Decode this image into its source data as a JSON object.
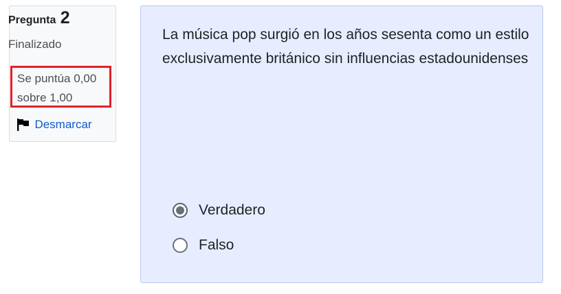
{
  "question_info": {
    "label": "Pregunta",
    "number": "2",
    "state": "Finalizado",
    "grade": "Se puntúa 0,00 sobre 1,00",
    "flag_action": "Desmarcar"
  },
  "question": {
    "text": "La música pop surgió en los años sesenta como un estilo exclusivamente británico sin influencias estadounidenses",
    "options": [
      {
        "label": "Verdadero",
        "selected": true
      },
      {
        "label": "Falso",
        "selected": false
      }
    ]
  },
  "colors": {
    "highlight_border": "#e0202a",
    "link": "#0f5bd0",
    "question_background": "#e7edff",
    "info_background": "#f8f9fa"
  },
  "icons": {
    "flag": "flag-icon"
  }
}
